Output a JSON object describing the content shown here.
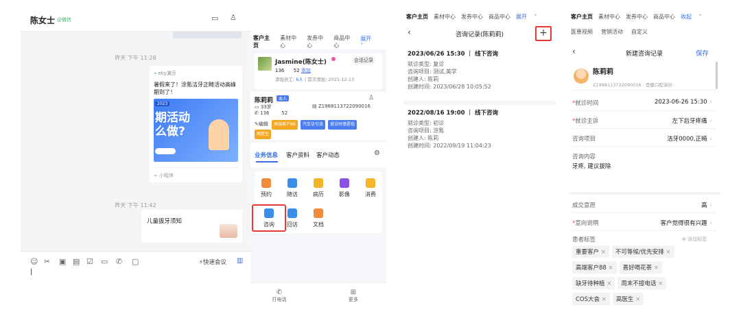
{
  "chat": {
    "contact_name": "陈女士",
    "contact_tag": "@微信",
    "time1": "昨天 下午 11:28",
    "card1": {
      "sender": "eky演示",
      "title": "暑假来了！涂氪洁牙正畸活动高峰期到了！",
      "banner_text": "期活动\n么做?",
      "banner_small": "2023",
      "footer": "小程序"
    },
    "time2": "昨天 下午 11:42",
    "card2": {
      "title": "儿童拔牙须知"
    },
    "quick_meeting": "快速会议",
    "input_caret": "|"
  },
  "panel2": {
    "tabs": [
      "客户主页",
      "素材中心",
      "发券中心",
      "商品中心"
    ],
    "expand": "展开",
    "customer": {
      "name": "Jasmine(陈女士)",
      "session_btn": "会话记录",
      "phone": "136",
      "count": "52",
      "add_link": "添加",
      "add_info_prefix": "添加员工: ",
      "add_info_count": "6人",
      "add_info_suffix": " | 首次添加: 2021-12-13"
    },
    "profile": {
      "name": "陈莉莉",
      "self_badge": "本人",
      "age": "33岁",
      "id": "Z19881137220900​16",
      "phone": "136",
      "phone2": "52",
      "edit": "编辑",
      "tags": [
        {
          "text": "高端客户88",
          "color": "#f5a623"
        },
        {
          "text": "汽车访引流",
          "color": "#4a7cf0"
        },
        {
          "text": "就诊时意愿低",
          "color": "#4a7cf0"
        },
        {
          "text": "高医生",
          "color": "#f5a623"
        }
      ]
    },
    "subtabs": [
      "业务信息",
      "客户资料",
      "客户动态"
    ],
    "grid": [
      {
        "label": "预约",
        "color": "#f08a3c"
      },
      {
        "label": "随访",
        "color": "#3a8ee8"
      },
      {
        "label": "病历",
        "color": "#f3b529"
      },
      {
        "label": "影像",
        "color": "#8a52e0"
      },
      {
        "label": "消费",
        "color": "#f3b529"
      },
      {
        "label": "咨询",
        "color": "#3a8ee8"
      },
      {
        "label": "回访",
        "color": "#3a8ee8"
      },
      {
        "label": "文档",
        "color": "#f08a3c"
      }
    ],
    "bottom": [
      "打电话",
      "更多"
    ]
  },
  "panel3": {
    "tabs": [
      "客户主页",
      "素材中心",
      "发券中心",
      "商品中心"
    ],
    "expand": "展开",
    "title": "咨询记录(陈莉莉)",
    "records": [
      {
        "header": "2023/06/26 15:30 ｜ 线下咨询",
        "lines": [
          "就诊类型: 复诊",
          "咨询项目: 测试,美学",
          "创建人: 陈莉",
          "创建时间: 2023/06/28 10:05:52"
        ]
      },
      {
        "header": "2022/08/16 19:00 ｜ 线下咨询",
        "lines": [
          "就诊类型: 初诊",
          "咨询项目: 涂氪",
          "创建人: 陈莉",
          "创建时间: 2022/09/19 11:04:23"
        ]
      }
    ]
  },
  "panel4": {
    "tabs": [
      "客户主页",
      "素材中心",
      "发券中心",
      "商品中心"
    ],
    "collapse": "收起",
    "tabs2": [
      "医患视频",
      "营销活动",
      "自定义"
    ],
    "title": "新建咨询记录",
    "save": "保存",
    "patient_name": "陈莉莉",
    "patient_sub": "Z19881137220900​16 · 登健口腔演示",
    "rows": [
      {
        "label": "就诊时间",
        "value": "2023-06-26 15:30",
        "required": true
      },
      {
        "label": "就诊主诉",
        "value": "左下后牙疼痛",
        "required": true
      },
      {
        "label": "咨询项目",
        "value": "洁牙0000,正畸",
        "required": false
      }
    ],
    "content_label": "咨询内容",
    "content_value": "牙疼, 建议拔除",
    "deal_label": "成交意愿",
    "deal_value": "高",
    "intent_label": "意向说明",
    "intent_value": "客户觉得很有兴趣",
    "tags_label": "患者标签",
    "add_tag": "添加标签",
    "tags": [
      "重要客户",
      "不可等候/优先安排",
      "高端客户88",
      "喜好喝花茶",
      "缺牙待种植",
      "周末不接电话",
      "COS大会",
      "高医生"
    ]
  }
}
